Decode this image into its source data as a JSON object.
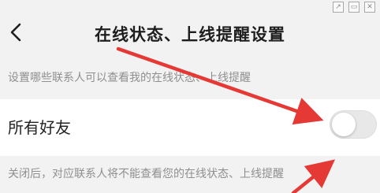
{
  "window_controls": [
    "external-link-icon",
    "minimize-icon",
    "close-icon"
  ],
  "header": {
    "back_icon": "‹",
    "title": "在线状态、上线提醒设置"
  },
  "description": "设置哪些联系人可以查看我的在线状态、上线提醒",
  "setting": {
    "label": "所有好友",
    "toggle_on": false
  },
  "note": "关闭后，对应联系人将不能查看您的在线状态、上线提醒",
  "colors": {
    "background": "#f2f2f2",
    "row": "#ffffff",
    "annotation_arrow": "#e53935"
  }
}
